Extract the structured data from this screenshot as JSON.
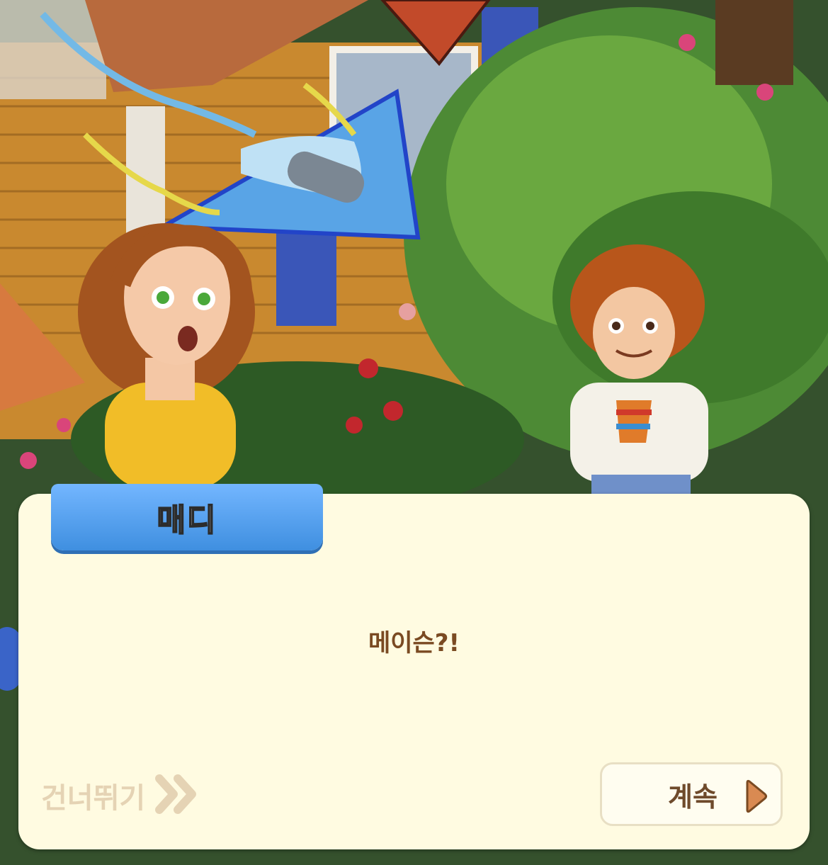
{
  "speaker": {
    "name": "매디"
  },
  "dialog": {
    "text": "메이슨?!"
  },
  "controls": {
    "skip_label": "건너뛰기",
    "continue_label": "계속"
  },
  "icons": {
    "skip": "double-chevron-right-icon",
    "continue": "play-arrow-icon"
  },
  "colors": {
    "dialog_bg": "#fffbe1",
    "name_tab": "#4f9ff0",
    "text_brown": "#7a4a22",
    "skip_text": "#e5d3b4"
  }
}
